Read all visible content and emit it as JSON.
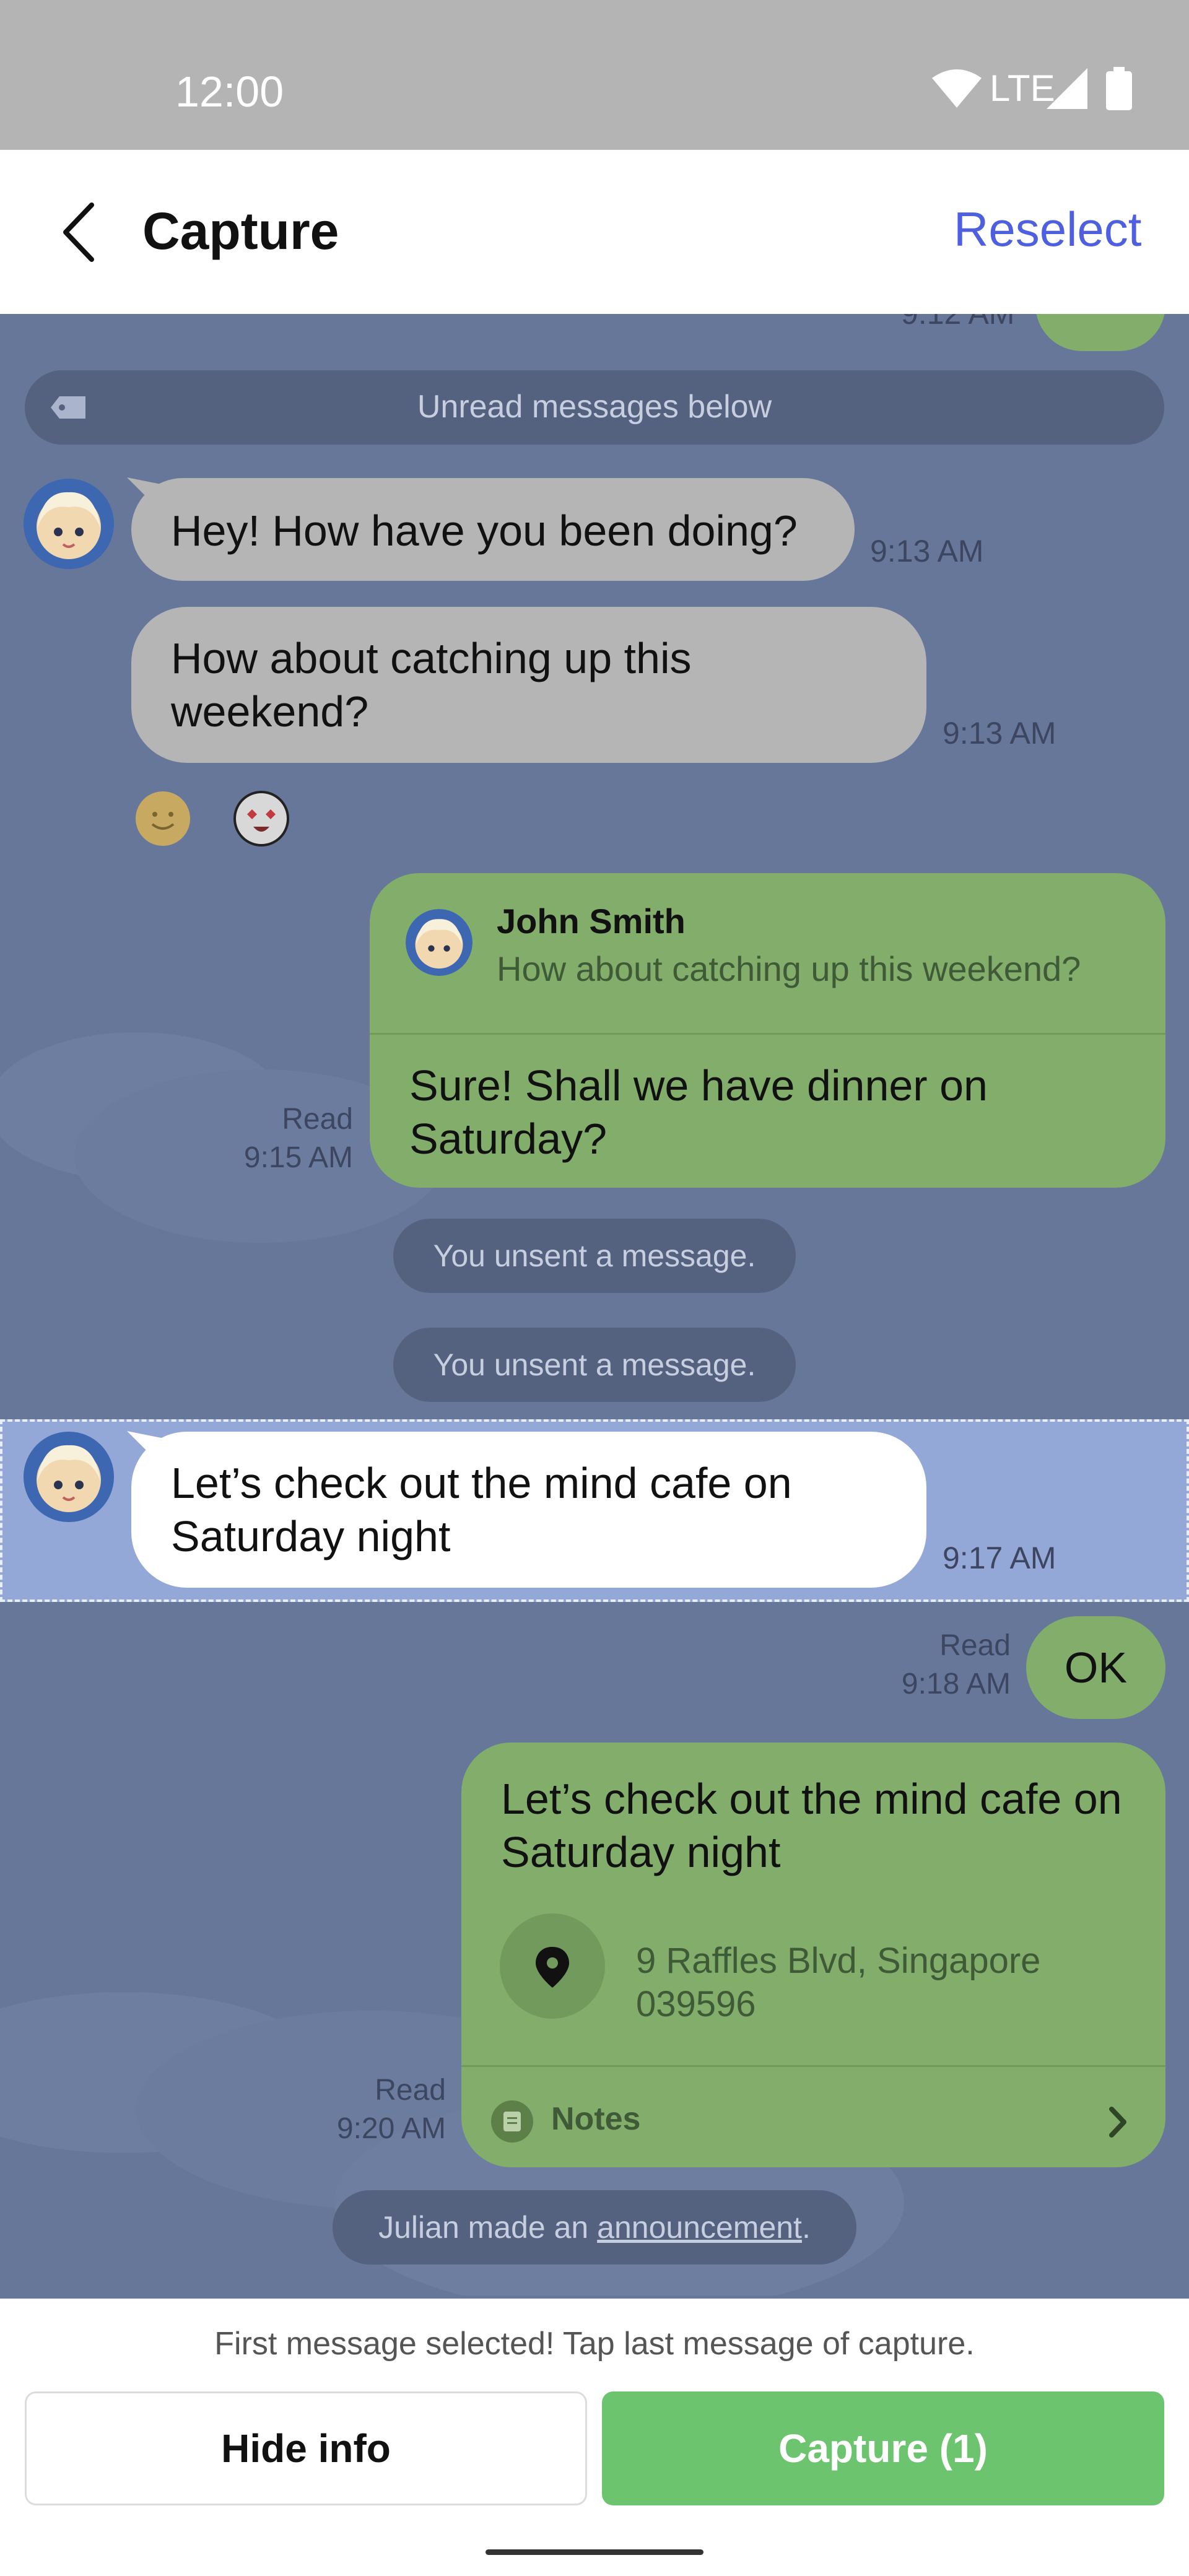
{
  "status_bar": {
    "time": "12:00",
    "network": "LTE"
  },
  "header": {
    "title": "Capture",
    "reselect_label": "Reselect"
  },
  "chat": {
    "top_time": "9:12 AM",
    "unread_banner": "Unread messages below",
    "msg1": {
      "text": "Hey! How have you been doing?",
      "time": "9:13 AM"
    },
    "msg2": {
      "text": "How about catching up this weekend?",
      "time": "9:13 AM"
    },
    "reply": {
      "quoted_name": "John Smith",
      "quoted_text": "How about catching up this weekend?",
      "text": "Sure! Shall we have dinner on Saturday?",
      "read": "Read",
      "time": "9:15 AM"
    },
    "unsent1": "You unsent a message.",
    "unsent2": "You unsent a message.",
    "selected_msg": {
      "text": "Let’s check out the mind cafe on Saturday night",
      "time": "9:17 AM"
    },
    "ok_msg": {
      "text": "OK",
      "read": "Read",
      "time": "9:18 AM"
    },
    "location_msg": {
      "text": "Let’s check out the mind cafe on Saturday night",
      "address": "9 Raffles Blvd, Singapore 039596",
      "notes_label": "Notes",
      "read": "Read",
      "time": "9:20 AM"
    },
    "announcement": {
      "prefix": "Julian made an ",
      "link": "announcement",
      "suffix": "."
    }
  },
  "footer": {
    "hint": "First message selected! Tap last message of capture.",
    "hide_info_label": "Hide info",
    "capture_label": "Capture (1)"
  },
  "colors": {
    "chat_bg": "#66779a",
    "selected_bg": "#93a8d6",
    "green_bubble": "#82ad6a",
    "accent": "#4e5fe0",
    "capture_button": "#6cc46e"
  }
}
